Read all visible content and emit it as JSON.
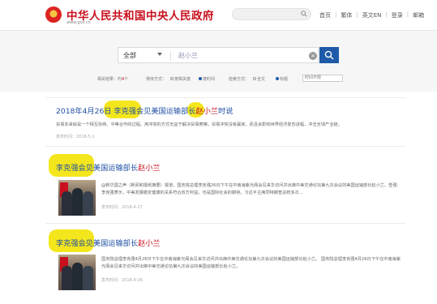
{
  "header": {
    "site_title": "中华人民共和国中央人民政府",
    "site_url": "www.gov.cn",
    "nav": [
      "首页",
      "繁体",
      "英文EN",
      "登录",
      "邮箱"
    ]
  },
  "search": {
    "scope": "全部",
    "query": "赵小兰"
  },
  "filters": {
    "count_label": "相关结果：约",
    "count": "4",
    "count_unit": "个",
    "sort_label": "排序方式：",
    "sort_options": [
      "按相关度",
      "按时间"
    ],
    "search_mode_label": "检索方式：",
    "search_modes": [
      "全文",
      "标题"
    ],
    "time_select": "时间不限"
  },
  "results": [
    {
      "title_pre": "2018年4月26日 李克强会见美国运输部长",
      "title_hl": "赵小兰",
      "title_post": "时说",
      "snippet": "贸易本来就是一个相互协商、平等合作的过程。用冲突的方式无益于解决贸易摩擦。贸易冲突没有赢家，而且会影响世界经济复苏进程，冲击全球产业链。",
      "date": "发布时间：2018-5-1"
    },
    {
      "title_pre": "李克强会见美国运输部长",
      "title_hl": "赵小兰",
      "title_post": "",
      "snippet": "@新华国之声（新闻和报纸摘要）报道，国务院总理李克强26日下午在中南海紫光阁会见来华访问并出席中美交通论坛第九次会议的美国运输部长赵小兰。查强：李克强表示，中美发展稳定健康的关系符合双方利益，也是国际社会的期待。习近平主席同特朗普总统多次...",
      "date": "发布时间：2018-4-27"
    },
    {
      "title_pre": "李克强会见美国运输部长",
      "title_hl": "赵小兰",
      "title_post": "",
      "snippet": "国务院总理李克强4月26日下午在中南海紫光阁会见来华访问并出席中美交通论坛第九次会议的美国运输部长赵小兰。 国务院总理李克强4月26日下午在中南海紫光阁会见来华访问并出席中美交通论坛第九次会议的美国运输部长赵小兰。",
      "date": "发布时间：2018-4-26"
    }
  ]
}
